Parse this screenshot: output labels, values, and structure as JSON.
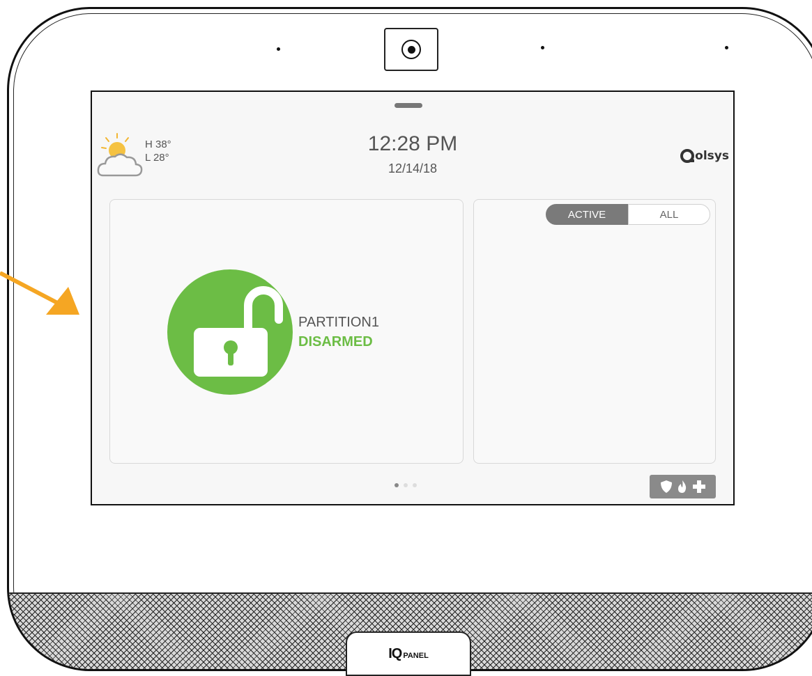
{
  "device": {
    "logo_iq": "IQ",
    "logo_panel": "PANEL"
  },
  "weather": {
    "high": "H 38°",
    "low": "L 28°",
    "icon": "partly-cloudy-icon"
  },
  "header": {
    "time": "12:28 PM",
    "date": "12/14/18",
    "brand": "olsys"
  },
  "partition": {
    "name": "PARTITION1",
    "status": "DISARMED",
    "status_color": "#6cbd45",
    "icon": "unlocked-padlock-icon"
  },
  "alerts_panel": {
    "tabs": [
      {
        "label": "ACTIVE",
        "selected": true
      },
      {
        "label": "ALL",
        "selected": false
      }
    ]
  },
  "status_leds": [
    "#5cb85c",
    "#f0ad4e",
    "#a8d08d",
    "#e04545"
  ],
  "pagination": {
    "current": 1,
    "total": 3
  },
  "emergency": {
    "icons": [
      "shield-icon",
      "fire-icon",
      "plus-icon"
    ]
  },
  "colors": {
    "accent_green": "#6cbd45",
    "pointer_arrow": "#f5a623"
  }
}
